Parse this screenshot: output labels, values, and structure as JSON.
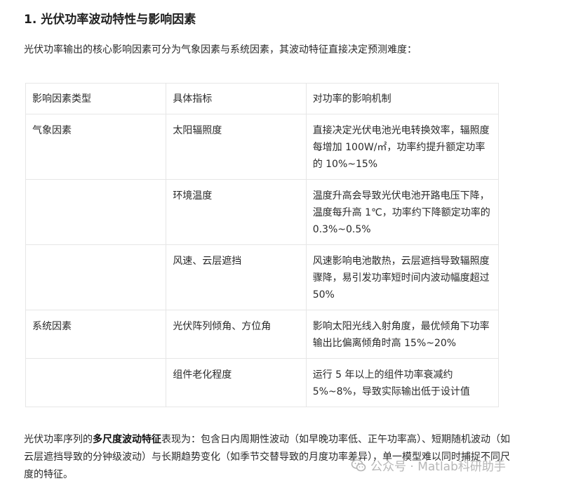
{
  "section": {
    "number": "1.",
    "title": "光伏功率波动特性与影响因素"
  },
  "intro": "光伏功率输出的核心影响因素可分为气象因素与系统因素，其波动特征直接决定预测难度：",
  "table": {
    "headers": [
      "影响因素类型",
      "具体指标",
      "对功率的影响机制"
    ],
    "rows": [
      {
        "category": "气象因素",
        "indicator": "太阳辐照度",
        "mechanism": "直接决定光伏电池光电转换效率，辐照度每增加 100W/㎡，功率约提升额定功率的 10%~15%"
      },
      {
        "category": "",
        "indicator": "环境温度",
        "mechanism": "温度升高会导致光伏电池开路电压下降，温度每升高 1℃，功率约下降额定功率的 0.3%~0.5%"
      },
      {
        "category": "",
        "indicator": "风速、云层遮挡",
        "mechanism": "风速影响电池散热，云层遮挡导致辐照度骤降，易引发功率短时间内波动幅度超过 50%"
      },
      {
        "category": "系统因素",
        "indicator": "光伏阵列倾角、方位角",
        "mechanism": "影响太阳光线入射角度，最优倾角下功率输出比偏离倾角时高 15%~20%"
      },
      {
        "category": "",
        "indicator": "组件老化程度",
        "mechanism": "运行 5 年以上的组件功率衰减约 5%~8%，导致实际输出低于设计值"
      }
    ]
  },
  "summary": {
    "before": "光伏功率序列的",
    "emphasis": "多尺度波动特征",
    "after": "表现为：包含日内周期性波动（如早晚功率低、正午功率高）、短期随机波动（如云层遮挡导致的分钟级波动）与长期趋势变化（如季节交替导致的月度功率差异），单一模型难以同时捕捉不同尺度的特征。"
  },
  "watermark": {
    "text": "公众号 · Matlab科研助手",
    "icon": "wechat-icon"
  }
}
